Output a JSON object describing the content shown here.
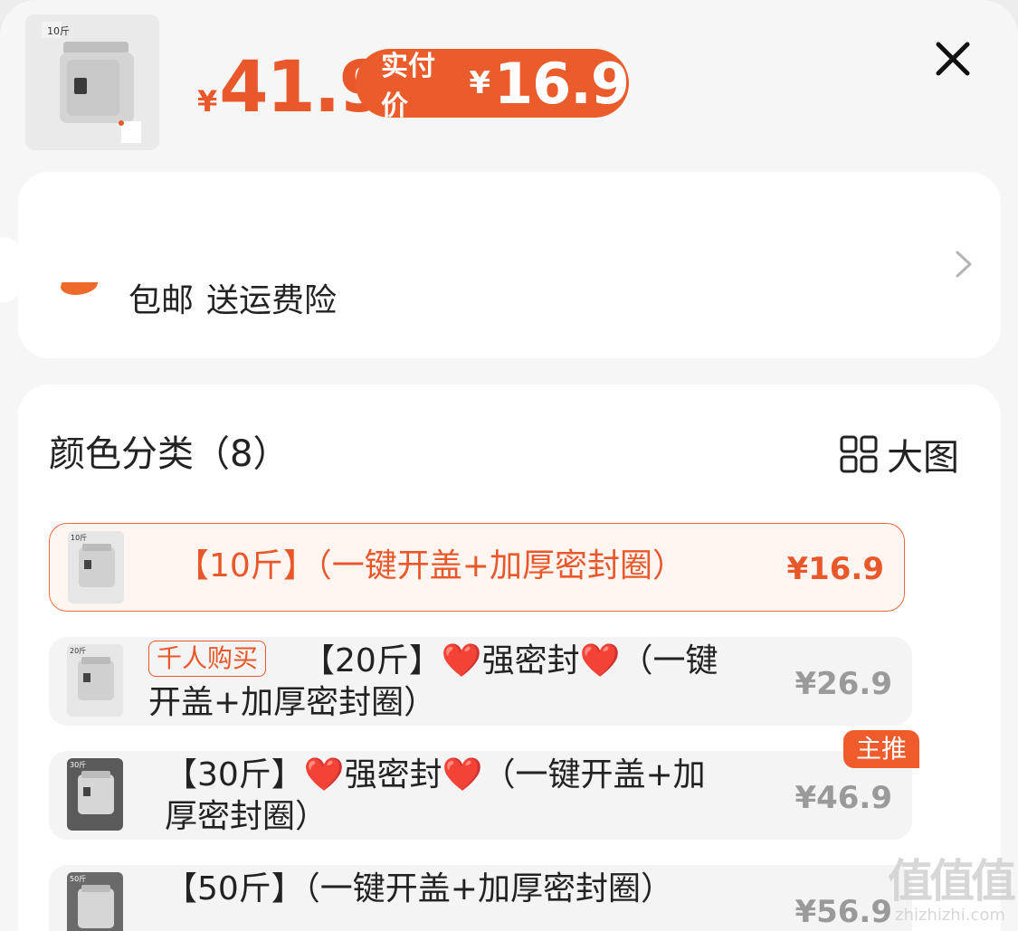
{
  "header": {
    "currency": "¥",
    "price": "41.9",
    "pay_label": "实付价",
    "pay_currency": "¥",
    "pay_price": "16.9",
    "close_icon": "close-icon",
    "thumb_text": "10斤"
  },
  "shipping": {
    "items": [
      "包邮",
      "送运费险"
    ],
    "chevron_icon": "chevron-right-icon"
  },
  "options": {
    "title": "颜色分类（8）",
    "big_image_label": "大图",
    "big_image_icon": "grid-icon",
    "items": [
      {
        "thumb_text": "10斤",
        "tag": "",
        "label": "【10斤】（一键开盖+加厚密封圈）",
        "price": "¥16.9",
        "selected": true
      },
      {
        "thumb_text": "20斤",
        "tag": "千人购买",
        "label": "【20斤】❤️强密封❤️（一键开盖+加厚密封圈）",
        "price": "¥26.9",
        "selected": false
      },
      {
        "thumb_text": "30斤",
        "tag": "",
        "label": "【30斤】❤️强密封❤️（一键开盖+加厚密封圈）",
        "price": "¥46.9",
        "selected": false,
        "corner_badge": "主推"
      },
      {
        "thumb_text": "50斤",
        "tag": "",
        "label": "【50斤】（一键开盖+加厚密封圈）",
        "price": "¥56.9",
        "selected": false
      }
    ]
  },
  "watermark": {
    "line1": "值值值",
    "line2": "zhizhizhi.com"
  },
  "colors": {
    "accent": "#e9582a",
    "selected_bg": "#fff6f2",
    "muted_price": "#9a9a9a"
  }
}
